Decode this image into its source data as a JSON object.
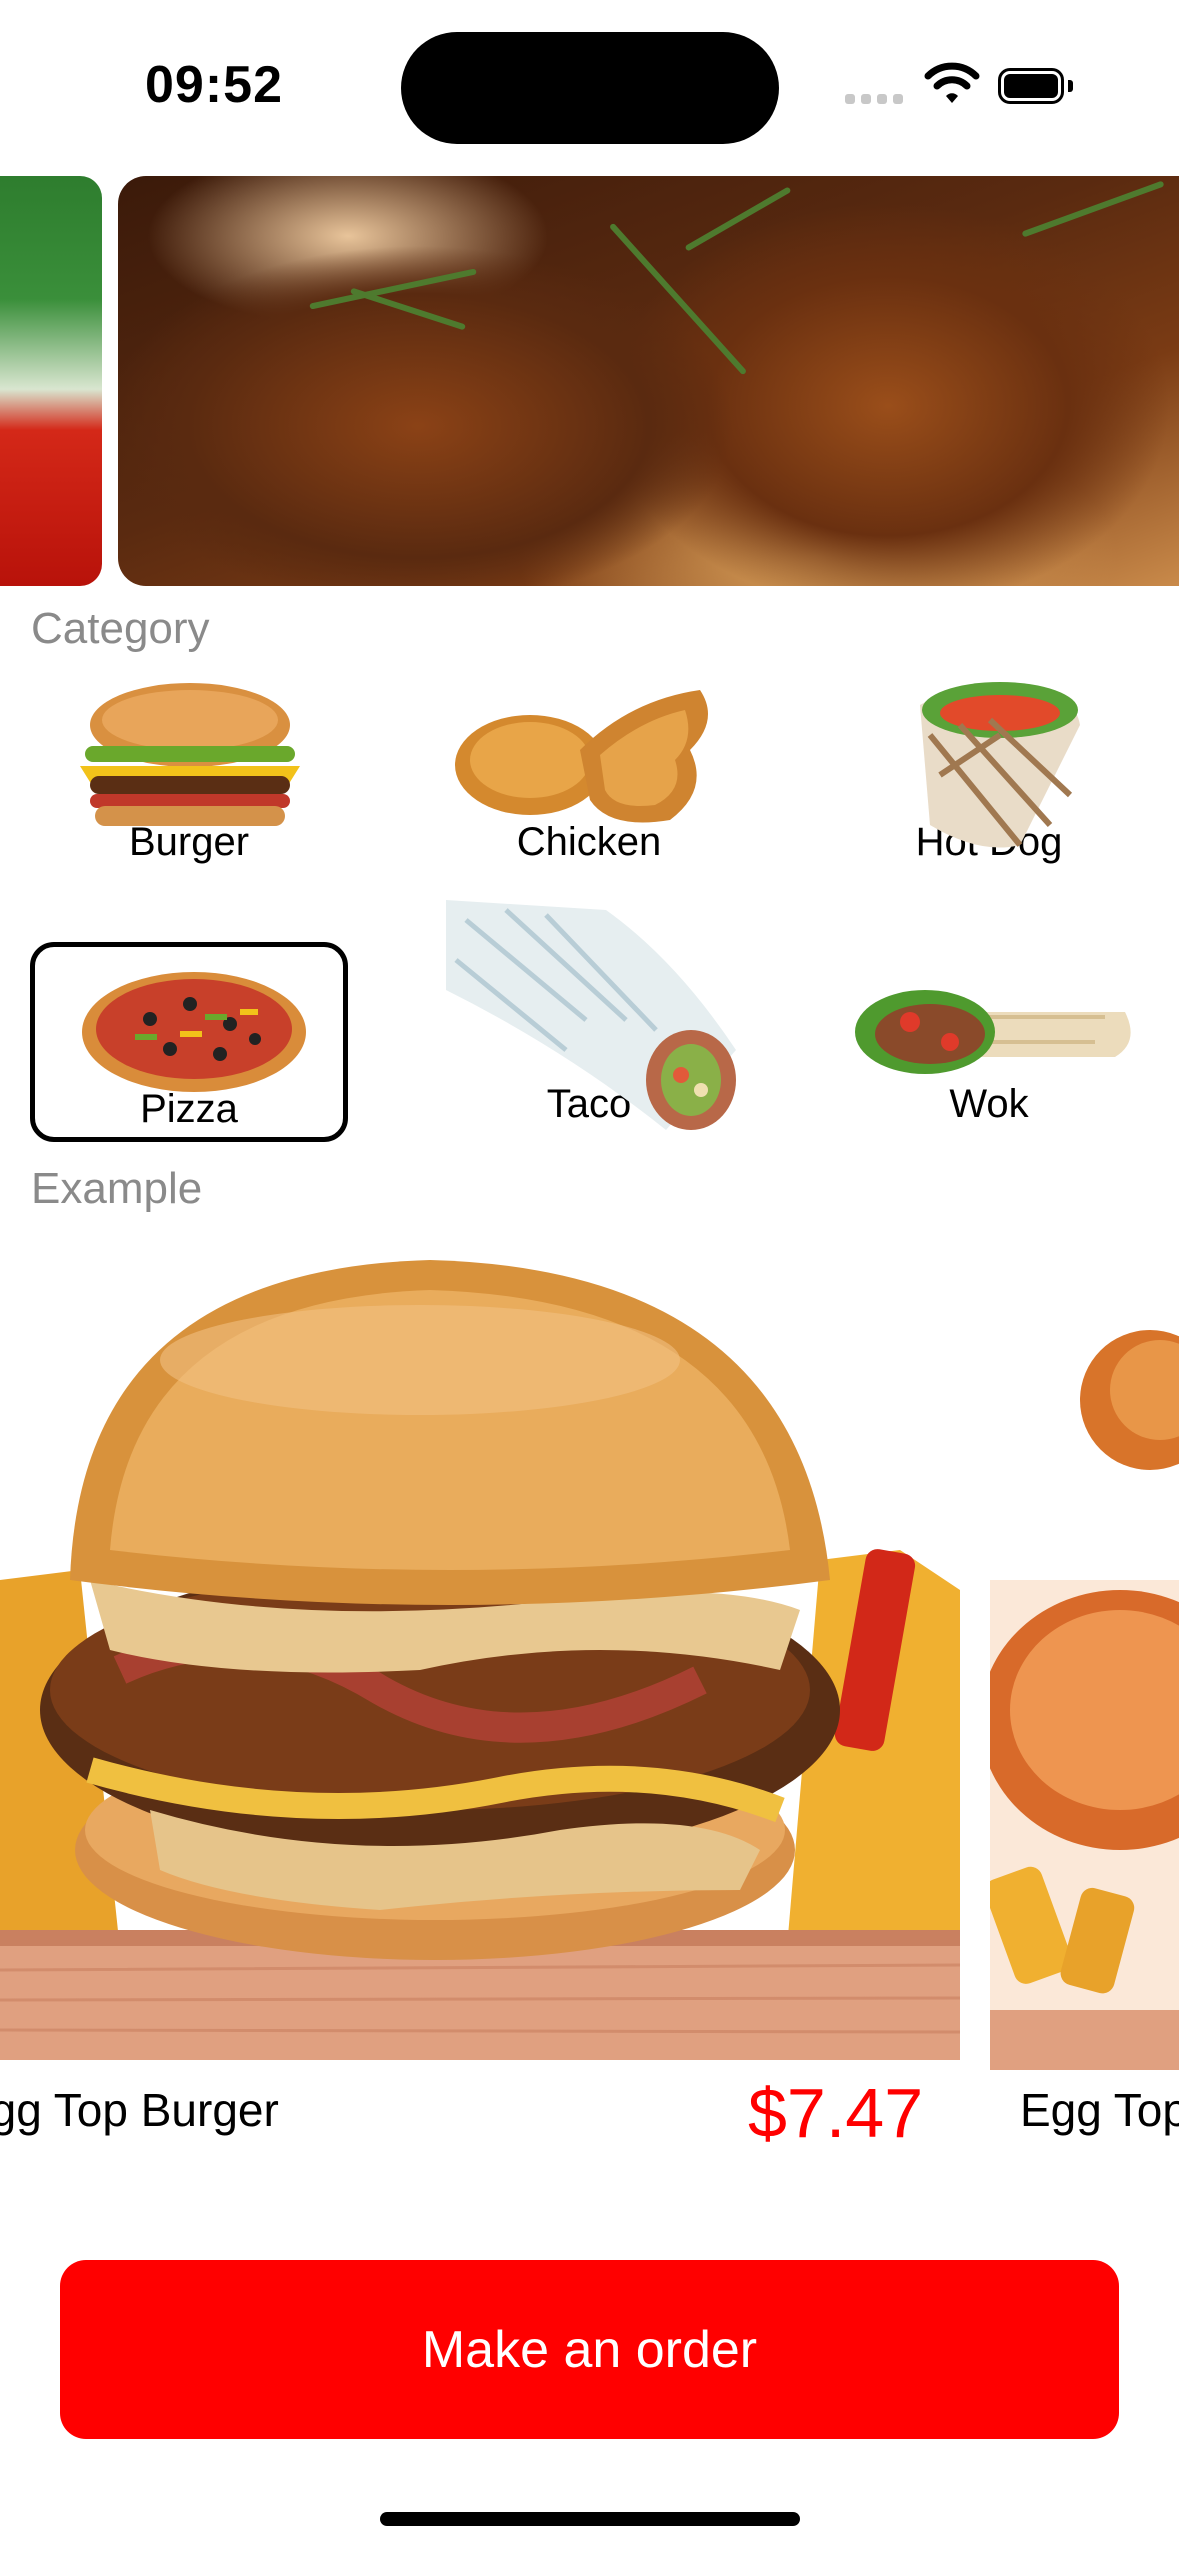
{
  "status_bar": {
    "time": "09:52"
  },
  "sections": {
    "category_title": "Category",
    "example_title": "Example"
  },
  "categories": [
    {
      "label": "Burger",
      "selected": false
    },
    {
      "label": "Chicken",
      "selected": false
    },
    {
      "label": "Hot Dog",
      "selected": false
    },
    {
      "label": "Pizza",
      "selected": true
    },
    {
      "label": "Taco",
      "selected": false
    },
    {
      "label": "Wok",
      "selected": false
    }
  ],
  "examples": [
    {
      "name": "Egg Top Burger",
      "price": "$7.47"
    },
    {
      "name": "Egg Top"
    }
  ],
  "order_button": {
    "label": "Make an order"
  },
  "colors": {
    "accent": "#ff0000",
    "section_title": "#8a8a8a"
  }
}
